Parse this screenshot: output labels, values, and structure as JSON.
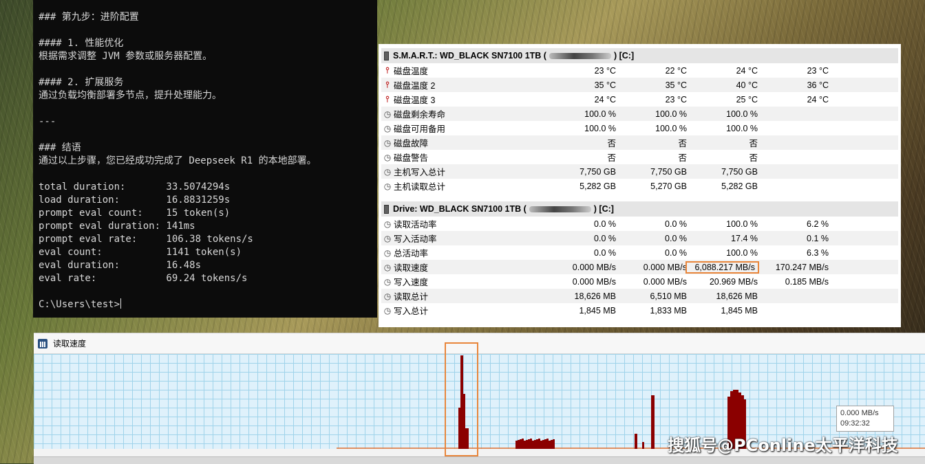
{
  "terminal": {
    "lines": [
      "### 第九步：进阶配置",
      "",
      "#### 1. 性能优化",
      "根据需求调整 JVM 参数或服务器配置。",
      "",
      "#### 2. 扩展服务",
      "通过负载均衡部署多节点，提升处理能力。",
      "",
      "---",
      "",
      "### 结语",
      "通过以上步骤，您已经成功完成了 Deepseek R1 的本地部署。",
      "",
      "total duration:       33.5074294s",
      "load duration:        16.8831259s",
      "prompt eval count:    15 token(s)",
      "prompt eval duration: 141ms",
      "prompt eval rate:     106.38 tokens/s",
      "eval count:           1141 token(s)",
      "eval duration:        16.48s",
      "eval rate:            69.24 tokens/s",
      "",
      "C:\\Users\\test>"
    ]
  },
  "hwinfo": {
    "sections": [
      {
        "title_prefix": "S.M.A.R.T.: WD_BLACK SN7100 1TB (",
        "title_suffix": ") [C:]",
        "rows": [
          {
            "icon": "thermometer-icon",
            "name": "磁盘温度",
            "values": [
              "23 °C",
              "22 °C",
              "24 °C",
              "23 °C"
            ]
          },
          {
            "icon": "thermometer-icon",
            "name": "磁盘温度 2",
            "values": [
              "35 °C",
              "35 °C",
              "40 °C",
              "36 °C"
            ]
          },
          {
            "icon": "thermometer-icon",
            "name": "磁盘温度 3",
            "values": [
              "24 °C",
              "23 °C",
              "25 °C",
              "24 °C"
            ]
          },
          {
            "icon": "clock-icon",
            "name": "磁盘剩余寿命",
            "values": [
              "100.0 %",
              "100.0 %",
              "100.0 %",
              ""
            ]
          },
          {
            "icon": "clock-icon",
            "name": "磁盘可用备用",
            "values": [
              "100.0 %",
              "100.0 %",
              "100.0 %",
              ""
            ]
          },
          {
            "icon": "clock-icon",
            "name": "磁盘故障",
            "values": [
              "否",
              "否",
              "否",
              ""
            ]
          },
          {
            "icon": "clock-icon",
            "name": "磁盘警告",
            "values": [
              "否",
              "否",
              "否",
              ""
            ]
          },
          {
            "icon": "clock-icon",
            "name": "主机写入总计",
            "values": [
              "7,750 GB",
              "7,750 GB",
              "7,750 GB",
              ""
            ]
          },
          {
            "icon": "clock-icon",
            "name": "主机读取总计",
            "values": [
              "5,282 GB",
              "5,270 GB",
              "5,282 GB",
              ""
            ]
          }
        ]
      },
      {
        "title_prefix": "Drive: WD_BLACK SN7100 1TB (",
        "title_suffix": ") [C:]",
        "rows": [
          {
            "icon": "clock-icon",
            "name": "读取活动率",
            "values": [
              "0.0 %",
              "0.0 %",
              "100.0 %",
              "6.2 %"
            ]
          },
          {
            "icon": "clock-icon",
            "name": "写入活动率",
            "values": [
              "0.0 %",
              "0.0 %",
              "17.4 %",
              "0.1 %"
            ]
          },
          {
            "icon": "clock-icon",
            "name": "总活动率",
            "values": [
              "0.0 %",
              "0.0 %",
              "100.0 %",
              "6.3 %"
            ]
          },
          {
            "icon": "clock-icon",
            "name": "读取速度",
            "values": [
              "0.000 MB/s",
              "0.000 MB/s",
              "6,088.217 MB/s",
              "170.247 MB/s"
            ],
            "highlight": 2
          },
          {
            "icon": "clock-icon",
            "name": "写入速度",
            "values": [
              "0.000 MB/s",
              "0.000 MB/s",
              "20.969 MB/s",
              "0.185 MB/s"
            ]
          },
          {
            "icon": "clock-icon",
            "name": "读取总计",
            "values": [
              "18,626 MB",
              "6,510 MB",
              "18,626 MB",
              ""
            ]
          },
          {
            "icon": "clock-icon",
            "name": "写入总计",
            "values": [
              "1,845 MB",
              "1,833 MB",
              "1,845 MB",
              ""
            ]
          }
        ]
      }
    ],
    "highlight_color": "#e8853a"
  },
  "graph": {
    "title": "读取速度",
    "tooltip_value": "0.000 MB/s",
    "tooltip_time": "09:32:32",
    "bar_color": "#8b0000",
    "baseline_color": "#e07030",
    "series_levels": [
      0,
      0,
      0,
      0,
      0,
      0,
      0,
      0,
      0,
      0,
      0,
      0,
      0,
      0,
      0,
      0,
      0,
      0,
      0,
      0,
      0,
      0,
      0,
      0,
      0,
      0,
      0,
      0,
      0,
      0,
      0,
      0,
      0,
      0,
      0,
      0,
      0,
      0,
      0,
      0,
      0,
      0,
      0,
      0,
      0,
      0,
      0,
      0,
      0,
      0,
      0,
      0,
      0,
      0,
      0,
      0,
      0,
      0,
      0,
      0,
      0,
      0,
      0,
      0,
      0,
      0,
      0,
      0,
      0,
      0,
      0,
      0,
      0,
      0,
      0,
      0,
      0,
      0,
      0,
      0,
      0,
      0,
      0,
      0,
      0,
      0,
      0,
      0,
      0,
      0,
      0,
      0,
      0,
      0,
      0,
      0,
      0,
      0,
      0,
      0,
      0,
      0,
      0,
      0,
      0,
      0,
      0,
      0,
      0,
      0,
      0,
      0,
      0,
      0,
      0,
      0,
      0,
      0,
      0,
      0,
      0,
      0,
      0,
      0,
      0,
      0,
      0,
      0,
      0,
      0,
      0,
      0,
      0,
      0,
      0,
      0,
      0,
      0,
      0,
      0,
      0,
      0,
      0,
      0,
      0,
      0,
      0,
      0,
      0,
      0,
      0,
      0,
      0,
      0,
      0,
      0,
      0,
      0,
      0,
      0,
      0,
      0,
      0,
      0,
      0,
      0,
      0,
      0,
      0,
      0,
      0,
      0,
      0,
      0,
      0,
      0,
      0,
      0,
      0,
      0,
      0,
      0,
      0,
      0,
      0,
      0,
      0,
      0,
      0,
      0,
      0,
      0,
      0,
      0,
      0,
      0,
      0,
      0,
      0,
      0,
      0,
      0,
      0,
      0,
      0,
      0,
      0,
      0,
      0,
      0,
      0,
      0,
      0,
      0,
      0,
      0,
      0,
      0,
      0,
      0,
      0,
      0,
      0,
      0,
      0,
      0,
      0,
      0,
      0,
      0,
      0,
      0,
      0,
      0,
      0,
      0,
      0,
      0,
      0,
      0,
      0,
      0,
      0,
      0,
      0,
      0,
      0,
      0,
      0,
      0,
      0,
      0,
      0,
      0,
      0,
      0,
      0,
      0,
      0,
      0,
      0,
      0,
      0,
      0,
      0,
      0,
      0,
      0,
      0,
      0,
      0,
      0,
      0,
      0,
      0,
      0,
      0,
      0,
      0,
      0,
      0,
      0,
      0,
      0,
      0,
      0,
      0,
      0,
      0,
      0,
      0,
      0,
      0,
      0,
      0,
      0,
      0,
      0,
      0,
      0,
      0,
      0,
      0,
      0,
      0,
      0,
      0,
      0,
      0,
      0,
      0,
      0,
      0,
      0,
      0,
      0,
      0,
      0,
      0,
      0,
      0,
      0,
      0,
      0,
      0,
      0,
      0,
      0,
      0,
      0,
      0,
      0,
      0,
      0,
      0,
      0,
      0,
      0,
      0,
      0,
      0,
      0,
      0,
      0,
      0,
      0,
      0,
      0,
      0,
      0,
      0,
      0,
      0,
      0,
      0,
      0,
      0,
      0,
      0,
      0,
      0,
      0,
      0,
      0,
      0,
      0,
      0,
      0,
      0,
      0,
      0,
      0,
      0,
      0,
      0,
      0,
      0,
      0,
      0,
      0,
      0,
      0,
      0,
      0,
      0,
      0,
      0,
      0,
      0,
      0,
      0,
      0,
      0,
      0,
      0,
      0,
      0,
      0,
      0,
      0
    ]
  },
  "watermark": "搜狐号@PConline太平洋科技"
}
